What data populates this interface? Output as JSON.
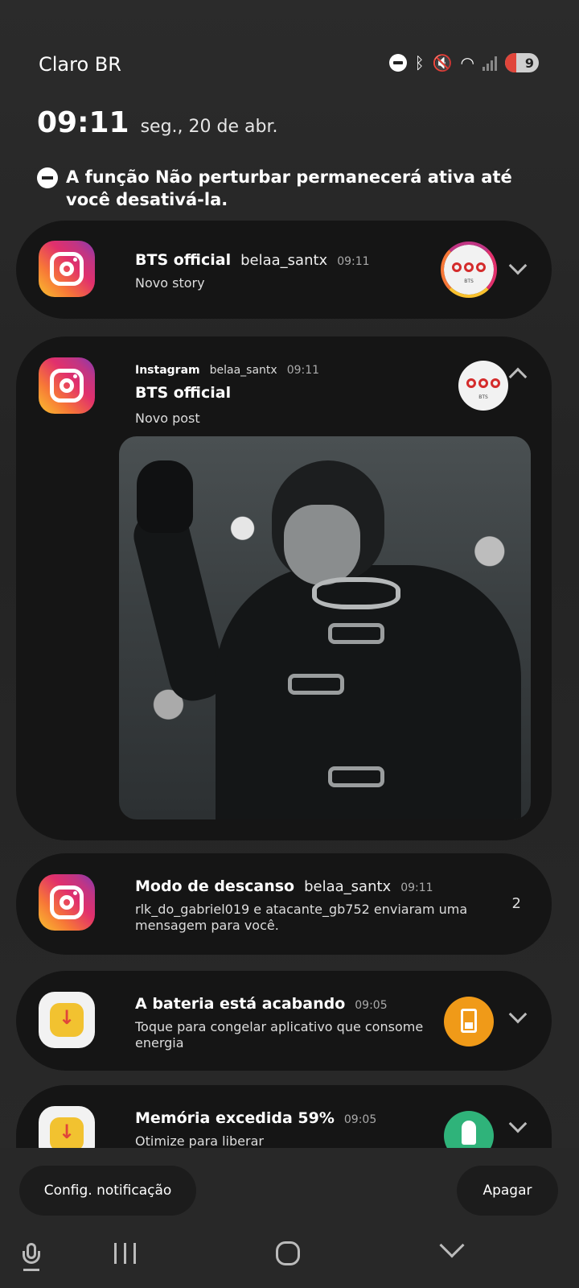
{
  "status": {
    "carrier": "Claro BR",
    "battery": "9"
  },
  "lockscreen": {
    "time": "09:11",
    "date": "seg., 20 de abr."
  },
  "dnd_notice": "A função Não perturbar permanecerá ativa até você desativá-la.",
  "notifications": [
    {
      "title": "BTS official",
      "user": "belaa_santx",
      "time": "09:11",
      "body": "Novo story"
    },
    {
      "app": "Instagram",
      "user": "belaa_santx",
      "time": "09:11",
      "title": "BTS official",
      "body": "Novo post"
    },
    {
      "title": "Modo de descanso",
      "user": "belaa_santx",
      "time": "09:11",
      "body": "rlk_do_gabriel019 e atacante_gb752 enviaram uma mensagem para você.",
      "count": "2"
    },
    {
      "title": "A bateria está acabando",
      "time": "09:05",
      "body": "Toque para congelar aplicativo que consome energia"
    },
    {
      "title": "Memória excedida 59%",
      "time": "09:05",
      "body": "Otimize para liberar"
    }
  ],
  "logo_text": "BTS",
  "actions": {
    "settings": "Config. notificação",
    "clear": "Apagar"
  },
  "colors": {
    "battery_orange": "#f09a18",
    "rocket_green": "#2fb37a",
    "low_battery_red": "#e0453a"
  }
}
